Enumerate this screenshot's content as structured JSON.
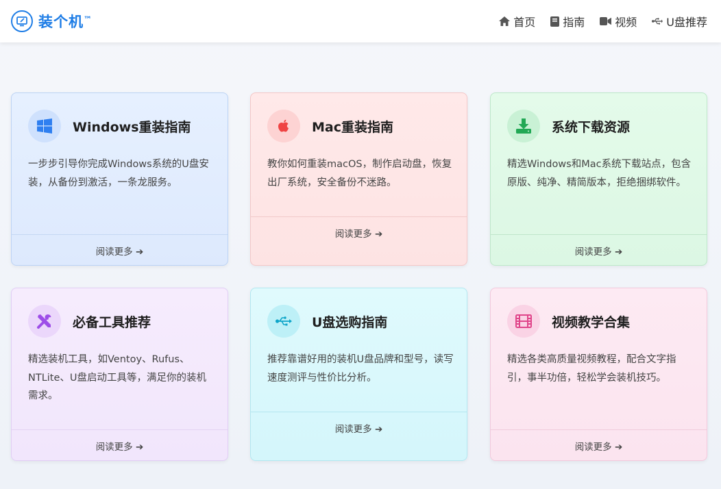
{
  "header": {
    "brand": "装个机",
    "brand_tm": "™",
    "nav": [
      {
        "label": "首页",
        "icon": "home-icon"
      },
      {
        "label": "指南",
        "icon": "book-icon"
      },
      {
        "label": "视频",
        "icon": "video-camera-icon"
      },
      {
        "label": "U盘推荐",
        "icon": "usb-icon"
      }
    ]
  },
  "cards": [
    {
      "title": "Windows重装指南",
      "desc": "一步步引导你完成Windows系统的U盘安装，从备份到激活，一条龙服务。",
      "link": "阅读更多 ➔",
      "icon": "windows-logo-icon",
      "accent": "#2f7ff0"
    },
    {
      "title": "Mac重装指南",
      "desc": "教你如何重装macOS，制作启动盘，恢复出厂系统，安全备份不迷路。",
      "link": "阅读更多 ➔",
      "icon": "apple-logo-icon",
      "accent": "#ef4444"
    },
    {
      "title": "系统下载资源",
      "desc": "精选Windows和Mac系统下载站点，包含原版、纯净、精简版本，拒绝捆绑软件。",
      "link": "阅读更多 ➔",
      "icon": "download-icon",
      "accent": "#22a855"
    },
    {
      "title": "必备工具推荐",
      "desc": "精选装机工具，如Ventoy、Rufus、NTLite、U盘启动工具等，满足你的装机需求。",
      "link": "阅读更多 ➔",
      "icon": "tools-icon",
      "accent": "#9d4de8"
    },
    {
      "title": "U盘选购指南",
      "desc": "推荐靠谱好用的装机U盘品牌和型号，读写速度测评与性价比分析。",
      "link": "阅读更多 ➔",
      "icon": "usb-icon",
      "accent": "#0ea5c9"
    },
    {
      "title": "视频教学合集",
      "desc": "精选各类高质量视频教程，配合文字指引，事半功倍，轻松学会装机技巧。",
      "link": "阅读更多 ➔",
      "icon": "film-icon",
      "accent": "#e0458a"
    }
  ]
}
